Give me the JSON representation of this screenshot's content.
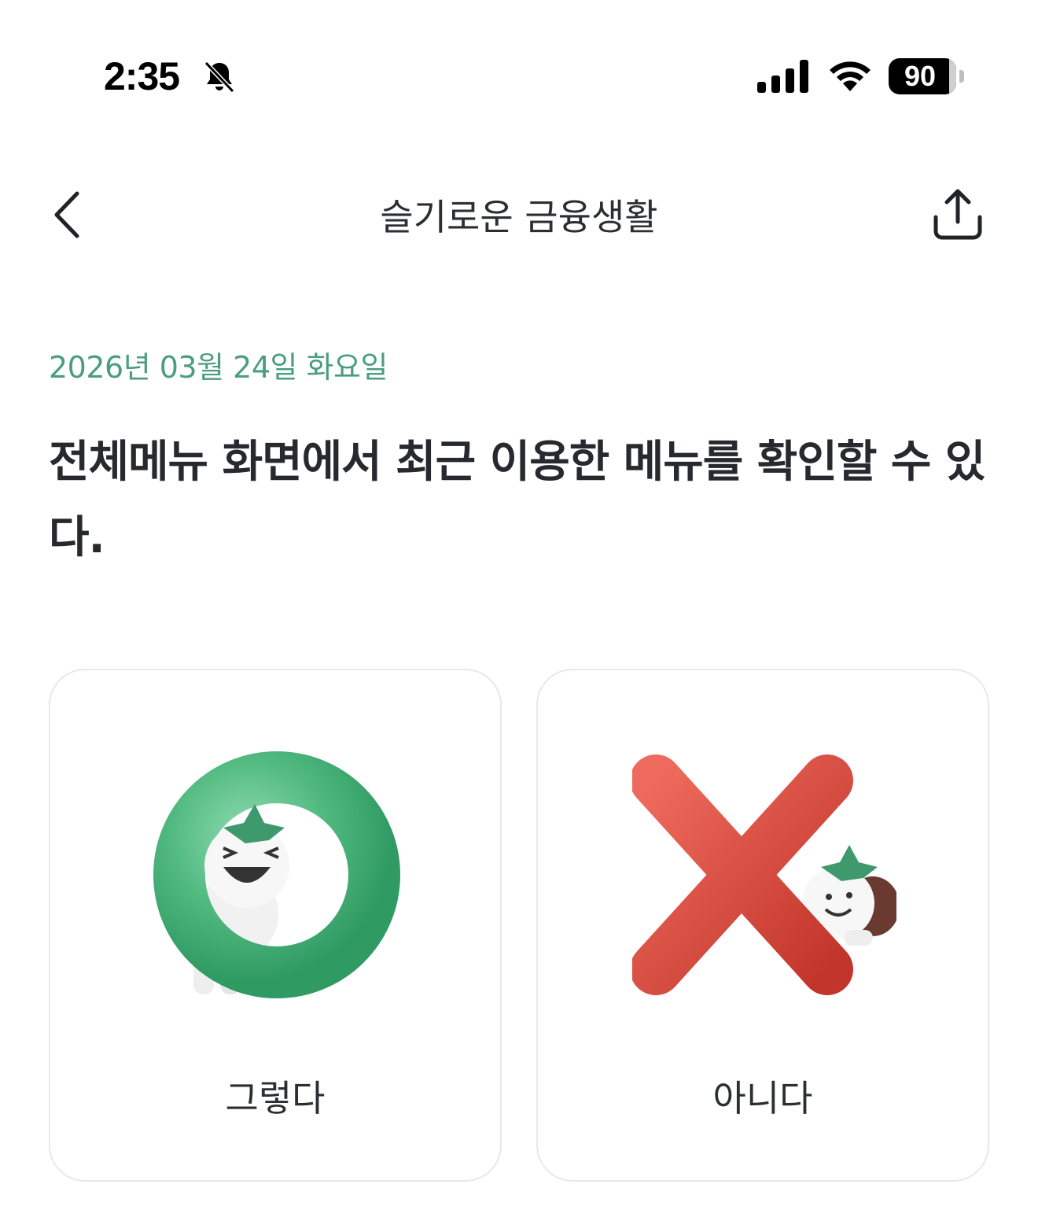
{
  "status_bar": {
    "time": "2:35",
    "battery_level": "90",
    "battery_fraction": 0.9,
    "icons": [
      "bell-slash-icon",
      "cellular-signal-icon",
      "wifi-icon",
      "battery-icon"
    ]
  },
  "nav": {
    "title": "슬기로운 금융생활",
    "back_icon": "chevron-left-icon",
    "share_icon": "share-icon"
  },
  "quiz": {
    "date": "2026년 03월 24일 화요일",
    "question": "전체메뉴 화면에서 최근 이용한 메뉴를 확인할 수 있다.",
    "choices": [
      {
        "label": "그렇다",
        "icon": "green-o-mascot-icon",
        "color": "#4fb87f"
      },
      {
        "label": "아니다",
        "icon": "red-x-mascot-icon",
        "color": "#d9473b"
      }
    ]
  },
  "colors": {
    "accent": "#4a9d82",
    "card_border": "#e6e8eb"
  }
}
